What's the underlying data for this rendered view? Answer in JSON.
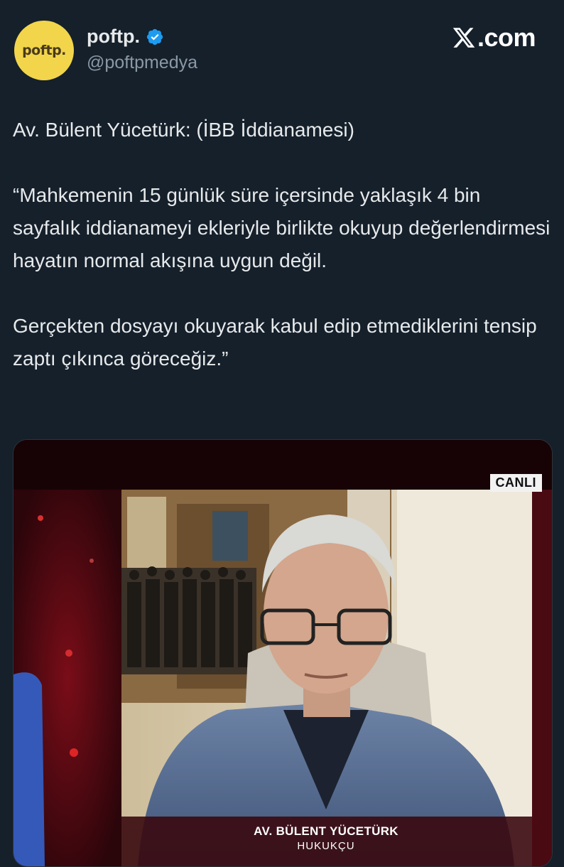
{
  "header": {
    "avatar_text": "poftp.",
    "display_name": "poftp.",
    "handle": "@poftpmedya",
    "brand": ".com"
  },
  "tweet": {
    "lines": [
      "Av. Bülent Yücetürk:  (İBB İddianamesi)",
      "“Mahkemenin 15 günlük süre içersinde yaklaşık 4 bin sayfalık iddianameyi ekleriyle birlikte okuyup değerlendirmesi hayatın normal akışına uygun değil.",
      "Gerçekten dosyayı okuyarak kabul edip etmediklerini tensip zaptı çıkınca göreceğiz.”"
    ]
  },
  "media": {
    "live_badge": "CANLI",
    "lower_third_name": "AV. BÜLENT YÜCETÜRK",
    "lower_third_title": "HUKUKÇU"
  },
  "colors": {
    "background": "#15202b",
    "avatar": "#f2d54b",
    "verified": "#1d9bf0",
    "handle": "#8b98a5"
  }
}
